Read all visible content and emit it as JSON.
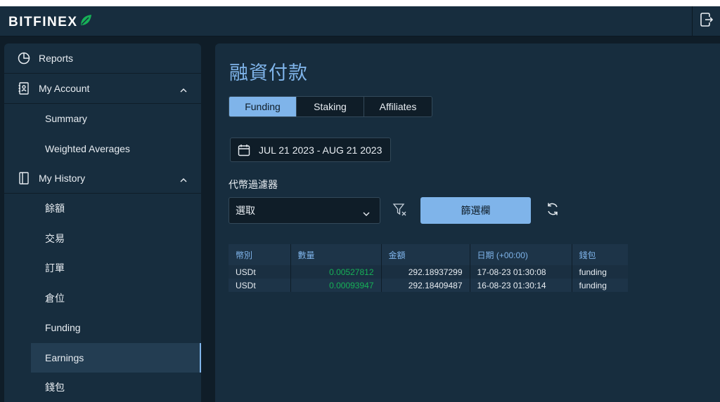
{
  "app": {
    "logo_text": "BITFINEX",
    "accent": "#7fb4ea",
    "green": "#16b157"
  },
  "sidebar": {
    "reports": "Reports",
    "my_account": {
      "label": "My Account",
      "items": [
        "Summary",
        "Weighted Averages"
      ]
    },
    "my_history": {
      "label": "My History",
      "items": [
        "餘額",
        "交易",
        "訂單",
        "倉位",
        "Funding",
        "Earnings",
        "錢包"
      ],
      "active": "Earnings"
    }
  },
  "main": {
    "title": "融資付款",
    "tabs": [
      "Funding",
      "Staking",
      "Affiliates"
    ],
    "active_tab": "Funding",
    "date_range": "JUL 21 2023 - AUG 21 2023",
    "filter_label": "代幣過濾器",
    "select_value": "選取",
    "apply_label": "篩選欄"
  },
  "table": {
    "headers": [
      "幣別",
      "數量",
      "金額",
      "日期 (+00:00)",
      "錢包"
    ],
    "rows": [
      [
        "USDt",
        "0.00527812",
        "292.18937299",
        "17-08-23 01:30:08",
        "funding"
      ],
      [
        "USDt",
        "0.00093947",
        "292.18409487",
        "16-08-23 01:30:14",
        "funding"
      ]
    ]
  }
}
